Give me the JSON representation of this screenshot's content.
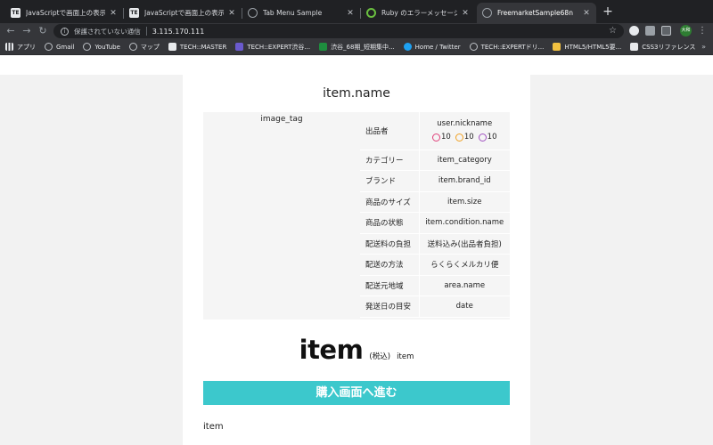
{
  "browser": {
    "tabs": [
      {
        "title": "JavaScriptで画面上の表示を変え",
        "favicon": "TE",
        "active": false
      },
      {
        "title": "JavaScriptで画面上の表示を変え",
        "favicon": "TE",
        "active": false
      },
      {
        "title": "Tab Menu Sample",
        "favicon": "globe",
        "active": false
      },
      {
        "title": "Ruby のエラーメッセージを読み解",
        "favicon": "ruby",
        "active": false
      },
      {
        "title": "FreemarketSample68n",
        "favicon": "globe",
        "active": true
      }
    ],
    "omnibox": {
      "security_text": "保護されていない通信",
      "url": "3.115.170.111"
    },
    "profile_label": "大和",
    "bookmarks": [
      {
        "label": "アプリ",
        "icon": "apps-grid-icon",
        "color": "#e8eaed"
      },
      {
        "label": "Gmail",
        "icon": "globe-icon",
        "color": "#bdc1c6"
      },
      {
        "label": "YouTube",
        "icon": "globe-icon",
        "color": "#bdc1c6"
      },
      {
        "label": "マップ",
        "icon": "globe-icon",
        "color": "#bdc1c6"
      },
      {
        "label": "TECH::MASTER",
        "icon": "tm-logo-icon",
        "color": "#e8eaed"
      },
      {
        "label": "TECH::EXPERT渋谷...",
        "icon": "te-logo-icon",
        "color": "#6a5acd"
      },
      {
        "label": "渋谷_68期_短期集中...",
        "icon": "sheets-icon",
        "color": "#1e8e3e"
      },
      {
        "label": "Home / Twitter",
        "icon": "twitter-icon",
        "color": "#1da1f2"
      },
      {
        "label": "TECH::EXPERTドリ...",
        "icon": "globe-icon",
        "color": "#bdc1c6"
      },
      {
        "label": "HTML5/HTML5要...",
        "icon": "html5-icon",
        "color": "#f0c040"
      },
      {
        "label": "CSS3リファレンス",
        "icon": "css3-icon",
        "color": "#e8eaed"
      }
    ],
    "bookmarks_more": "»"
  },
  "page": {
    "item_name": "item.name",
    "image_tag": "image_tag",
    "details": {
      "seller_key": "出品者",
      "seller_name": "user.nickname",
      "ratings": {
        "good": "10",
        "normal": "10",
        "bad": "10"
      },
      "rows": [
        {
          "key": "カテゴリー",
          "value": "item_category"
        },
        {
          "key": "ブランド",
          "value": "item.brand_id"
        },
        {
          "key": "商品のサイズ",
          "value": "item.size"
        },
        {
          "key": "商品の状態",
          "value": "item.condition.name"
        },
        {
          "key": "配送料の負担",
          "value": "送料込み(出品者負担)"
        },
        {
          "key": "配送の方法",
          "value": "らくらくメルカリ便"
        },
        {
          "key": "配送元地域",
          "value": "area.name"
        },
        {
          "key": "発送日の目安",
          "value": "date"
        }
      ]
    },
    "price": "item",
    "tax_label": "(税込)",
    "tax_suffix": "item",
    "buy_button_label": "購入画面へ進む",
    "description": "item",
    "colors": {
      "buy_button": "#3cc8cc",
      "panel": "#f5f5f5",
      "background": "#f2f2f2"
    }
  }
}
